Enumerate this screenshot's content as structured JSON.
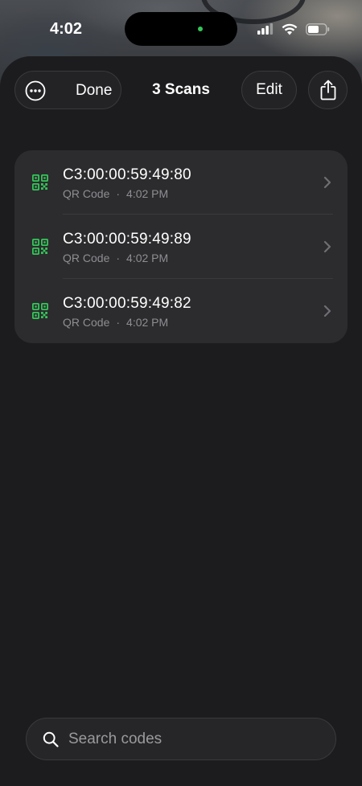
{
  "status_bar": {
    "time": "4:02",
    "icons": [
      "cellular-signal-icon",
      "wifi-icon",
      "battery-icon"
    ]
  },
  "header": {
    "more_icon": "ellipsis-circle-icon",
    "done_label": "Done",
    "title": "3 Scans",
    "edit_label": "Edit",
    "share_icon": "share-icon"
  },
  "scans": [
    {
      "code": "C3:00:00:59:49:80",
      "type": "QR Code",
      "separator": "·",
      "time": "4:02 PM"
    },
    {
      "code": "C3:00:00:59:49:89",
      "type": "QR Code",
      "separator": "·",
      "time": "4:02 PM"
    },
    {
      "code": "C3:00:00:59:49:82",
      "type": "QR Code",
      "separator": "·",
      "time": "4:02 PM"
    }
  ],
  "search": {
    "placeholder": "Search codes",
    "value": ""
  },
  "colors": {
    "accent_green": "#34c759",
    "background": "#1c1c1e",
    "card": "#2c2c2e",
    "secondary_text": "#8e8e93"
  }
}
